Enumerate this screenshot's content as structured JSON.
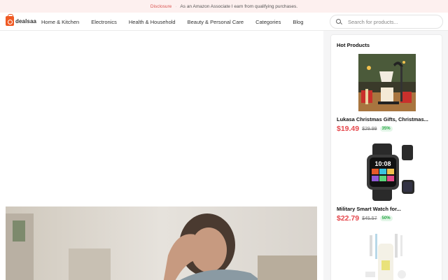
{
  "disclosure": {
    "label": "Disclosure",
    "text": "As an Amazon Associate I earn from qualifying purchases."
  },
  "logo": {
    "text": "dealsaa"
  },
  "nav": {
    "items": [
      {
        "label": "Home & Kitchen"
      },
      {
        "label": "Electronics"
      },
      {
        "label": "Health & Household"
      },
      {
        "label": "Beauty & Personal Care"
      },
      {
        "label": "Categories"
      },
      {
        "label": "Blog"
      }
    ]
  },
  "search": {
    "placeholder": "Search for products..."
  },
  "sidebar": {
    "title": "Hot Products",
    "products": [
      {
        "name": "Lukasa Christmas Gifts, Christmas...",
        "price": "$19.49",
        "old_price": "$29.99",
        "discount": "35%",
        "image": "candle-warmer-lamp"
      },
      {
        "name": "Military Smart Watch for...",
        "price": "$22.79",
        "old_price": "$45.57",
        "discount": "50%",
        "image": "smart-watch"
      },
      {
        "name": "",
        "price": "",
        "old_price": "",
        "discount": "",
        "image": "bottle-brush-set"
      }
    ]
  },
  "colors": {
    "accent": "#ef5a24",
    "price": "#e5484d",
    "discount": "#28a745",
    "disclosure_bg": "#fdf0ef"
  },
  "icons": [
    "shopping-bag-logo-icon",
    "search-icon"
  ]
}
